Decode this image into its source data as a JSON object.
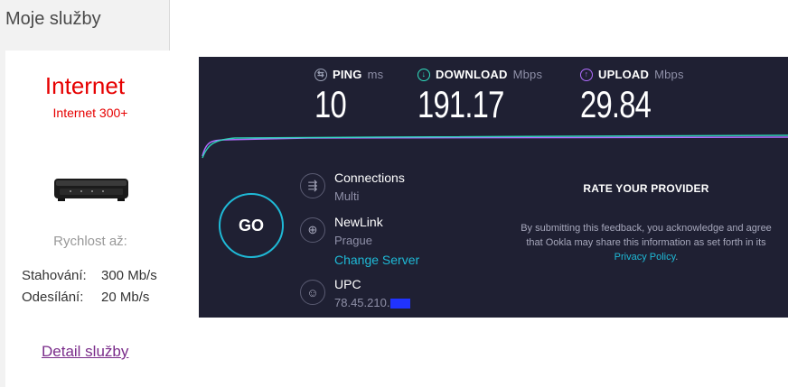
{
  "left_panel": {
    "title": "Moje služby",
    "service_name": "Internet",
    "service_plan": "Internet 300+",
    "speed_heading": "Rychlost až:",
    "download_label": "Stahování:",
    "download_value": "300 Mb/s",
    "upload_label": "Odesílání:",
    "upload_value": "20 Mb/s",
    "detail_link": "Detail služby",
    "accent_color": "#e60000"
  },
  "speedtest": {
    "ping": {
      "label": "PING",
      "unit": "ms",
      "value": "10",
      "icon": "ping-icon"
    },
    "download": {
      "label": "DOWNLOAD",
      "unit": "Mbps",
      "value": "191.17",
      "icon": "download-icon"
    },
    "upload": {
      "label": "UPLOAD",
      "unit": "Mbps",
      "value": "29.84",
      "icon": "upload-icon"
    },
    "go_label": "GO",
    "connections": {
      "title": "Connections",
      "value": "Multi",
      "icon": "connections-icon"
    },
    "server": {
      "name": "NewLink",
      "location": "Prague",
      "change_link": "Change Server",
      "icon": "globe-icon"
    },
    "isp": {
      "name": "UPC",
      "ip": "78.45.210.",
      "icon": "user-icon"
    },
    "rate": {
      "title": "RATE YOUR PROVIDER",
      "text": "By submitting this feedback, you acknowledge and agree that Ookla may share this information as set forth in its",
      "link": "Privacy Policy",
      "tail": "."
    },
    "colors": {
      "background": "#1f2033",
      "accent": "#1fb9d6",
      "ping": "#9aa0b5",
      "download": "#2fe0c0",
      "upload": "#b16dff"
    }
  }
}
